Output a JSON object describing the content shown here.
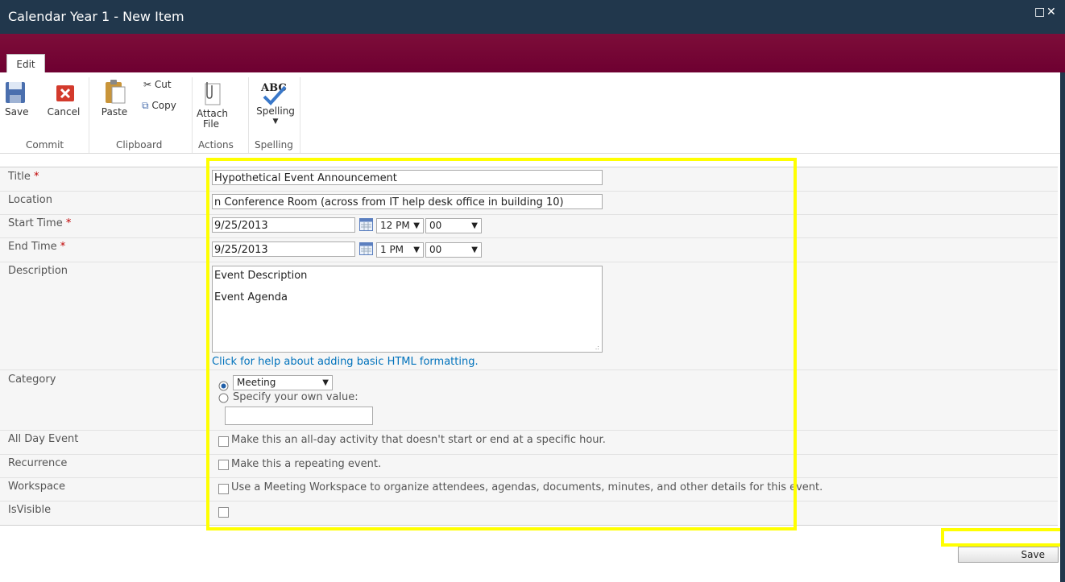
{
  "window": {
    "title": "Calendar Year 1 - New Item"
  },
  "ribbon": {
    "tab_label": "Edit",
    "save_label": "Save",
    "cancel_label": "Cancel",
    "paste_label": "Paste",
    "cut_label": "Cut",
    "copy_label": "Copy",
    "attach_line1": "Attach",
    "attach_line2": "File",
    "spelling_label": "Spelling",
    "spelling_icon_text": "ABC",
    "groups": {
      "commit": "Commit",
      "clipboard": "Clipboard",
      "actions": "Actions",
      "spelling": "Spelling"
    }
  },
  "form": {
    "title_label": "Title",
    "title_value": "Hypothetical Event Announcement",
    "location_label": "Location",
    "location_value": "n Conference Room (across from IT help desk office in building 10)",
    "start_label": "Start Time",
    "start_date": "9/25/2013",
    "start_hour": "12 PM",
    "start_minute": "00",
    "end_label": "End Time",
    "end_date": "9/25/2013",
    "end_hour": "1 PM",
    "end_minute": "00",
    "description_label": "Description",
    "description_line1": "Event Description",
    "description_line2": "Event Agenda",
    "help_link": "Click for help about adding basic HTML formatting.",
    "category_label": "Category",
    "category_value": "Meeting",
    "specify_label": "Specify your own value:",
    "allday_label": "All Day Event",
    "allday_text": "Make this an all-day activity that doesn't start or end at a specific hour.",
    "recurrence_label": "Recurrence",
    "recurrence_text": "Make this a repeating event.",
    "workspace_label": "Workspace",
    "workspace_text": "Use a Meeting Workspace to organize attendees, agendas, documents, minutes, and other details for this event.",
    "isvisible_label": "IsVisible",
    "required_marker": "*"
  },
  "footer": {
    "save_label": "Save"
  },
  "colors": {
    "titlebar": "#21374c",
    "maroon": "#7d0d39",
    "highlight": "#ffff00",
    "link": "#0072bc",
    "required": "#bf0000"
  }
}
